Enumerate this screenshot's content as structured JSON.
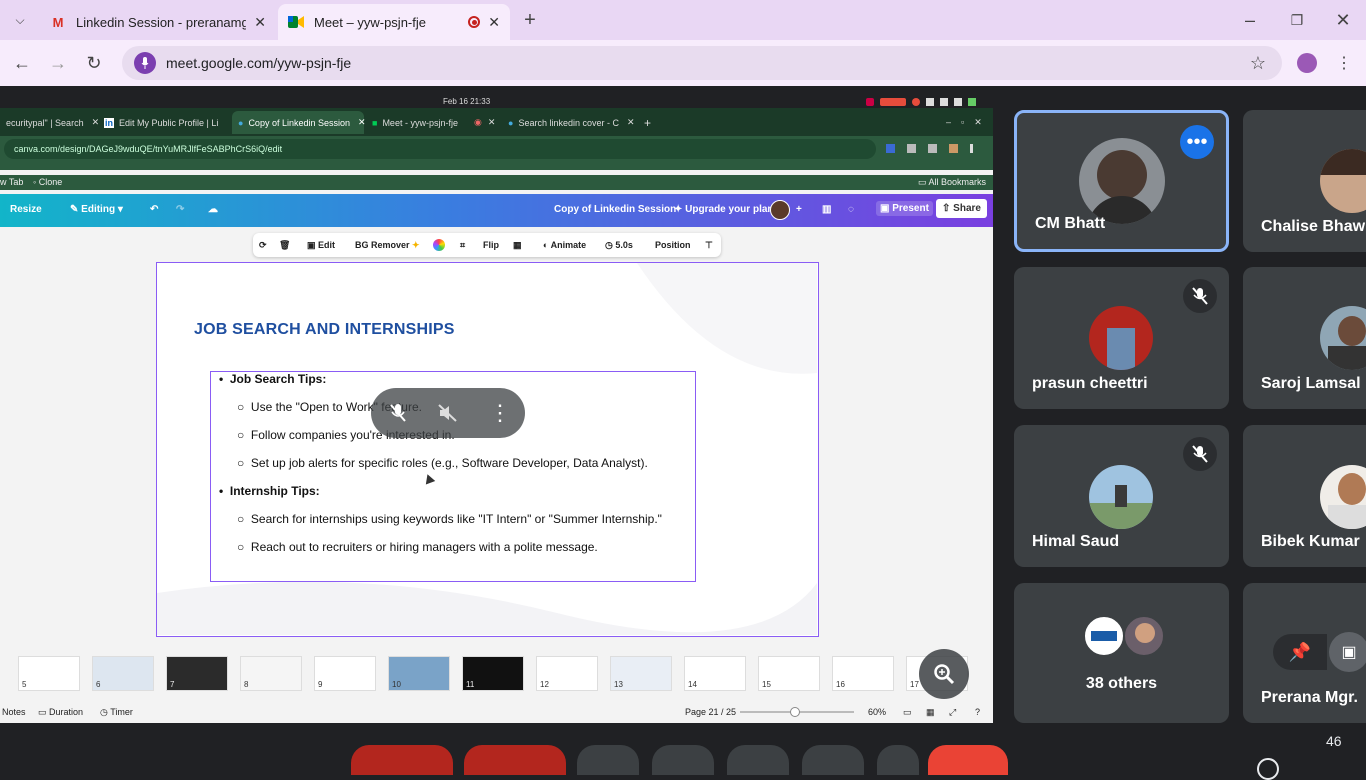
{
  "tabs": [
    {
      "label": "Linkedin Session - preranamgr2",
      "icon": "gmail-icon"
    },
    {
      "label": "Meet – yyw-psjn-fje",
      "icon": "meet-icon",
      "recording": true
    }
  ],
  "address": "meet.google.com/yyw-psjn-fje",
  "inner": {
    "clock": "Feb 16 21:33",
    "tabs": [
      "ecuritypal\" | Search",
      "Edit My Public Profile | Li",
      "Copy of Linkedin Session",
      "Meet - yyw-psjn-fje",
      "Search linkedin cover - C"
    ],
    "address": "canva.com/design/DAGeJ9wduQE/tnYuMRJlfFeSABPhCrS6iQ/edit",
    "bookmarks": [
      "w Tab",
      "Clone",
      "All Bookmarks"
    ],
    "canva": {
      "resize": "Resize",
      "editing": "Editing",
      "doc_title": "Copy of Linkedin Session",
      "upgrade": "Upgrade your plan",
      "present": "Present",
      "share": "Share"
    },
    "ctx": {
      "edit": "Edit",
      "bg_remover": "BG Remover",
      "flip": "Flip",
      "animate": "Animate",
      "duration": "5.0s",
      "position": "Position"
    },
    "slide": {
      "title": "JOB SEARCH AND INTERNSHIPS",
      "heading1": "Job Search Tips:",
      "tip1": "Use the \"Open to Work\" feature.",
      "tip2": "Follow companies you're interested in.",
      "tip3": "Set up job alerts for specific roles (e.g., Software Developer, Data Analyst).",
      "heading2": "Internship Tips:",
      "tip4": "Search for internships using keywords like \"IT Intern\" or \"Summer Internship.\"",
      "tip5": "Reach out to recruiters or hiring managers with a polite message."
    },
    "thumb_numbers": [
      "5",
      "6",
      "7",
      "8",
      "9",
      "10",
      "11",
      "12",
      "13",
      "14",
      "15",
      "16",
      "17"
    ],
    "status": {
      "notes": "Notes",
      "duration": "Duration",
      "timer": "Timer",
      "page": "Page 21 / 25",
      "zoom": "60%",
      "zoom_fraction": 0.6
    }
  },
  "participants": [
    {
      "name": "CM Bhatt",
      "active": true
    },
    {
      "name": "Chalise Bhaw"
    },
    {
      "name": "prasun cheettri",
      "muted": true
    },
    {
      "name": "Saroj Lamsal"
    },
    {
      "name": "Himal Saud",
      "muted": true
    },
    {
      "name": "Bibek Kumar"
    },
    {
      "name": "38 others"
    },
    {
      "name": "Prerana Mgr."
    }
  ],
  "participant_count": "46",
  "colors": {
    "accent": "#8ab4f8",
    "tabbar": "#e9d7f4",
    "slide_title": "#1f4fa0",
    "selection": "#8a5cf5"
  }
}
